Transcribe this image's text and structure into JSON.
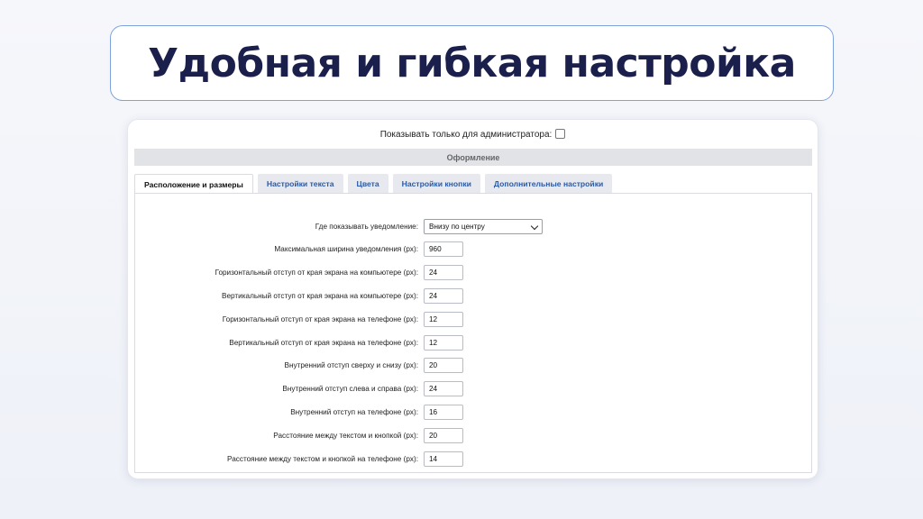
{
  "banner": {
    "title": "Удобная и гибкая настройка"
  },
  "admin_only": {
    "label": "Показывать только для администратора:",
    "checked": false
  },
  "section": {
    "title": "Оформление"
  },
  "tabs": [
    {
      "label": "Расположение и размеры",
      "active": true
    },
    {
      "label": "Настройки текста",
      "active": false
    },
    {
      "label": "Цвета",
      "active": false
    },
    {
      "label": "Настройки кнопки",
      "active": false
    },
    {
      "label": "Дополнительные настройки",
      "active": false
    }
  ],
  "form": {
    "position": {
      "label": "Где показывать уведомление:",
      "value": "Внизу по центру"
    },
    "fields": [
      {
        "label": "Максимальная ширина уведомления (px):",
        "value": "960"
      },
      {
        "label": "Горизонтальный отступ от края экрана на компьютере (px):",
        "value": "24"
      },
      {
        "label": "Вертикальный отступ от края экрана на компьютере (px):",
        "value": "24"
      },
      {
        "label": "Горизонтальный отступ от края экрана на телефоне (px):",
        "value": "12"
      },
      {
        "label": "Вертикальный отступ от края экрана на телефоне (px):",
        "value": "12"
      },
      {
        "label": "Внутренний отступ сверху и снизу (px):",
        "value": "20"
      },
      {
        "label": "Внутренний отступ слева и справа (px):",
        "value": "24"
      },
      {
        "label": "Внутренний отступ на телефоне (px):",
        "value": "16"
      },
      {
        "label": "Расстояние между текстом и кнопкой (px):",
        "value": "20"
      },
      {
        "label": "Расстояние между текстом и кнопкой на телефоне (px):",
        "value": "14"
      }
    ]
  }
}
